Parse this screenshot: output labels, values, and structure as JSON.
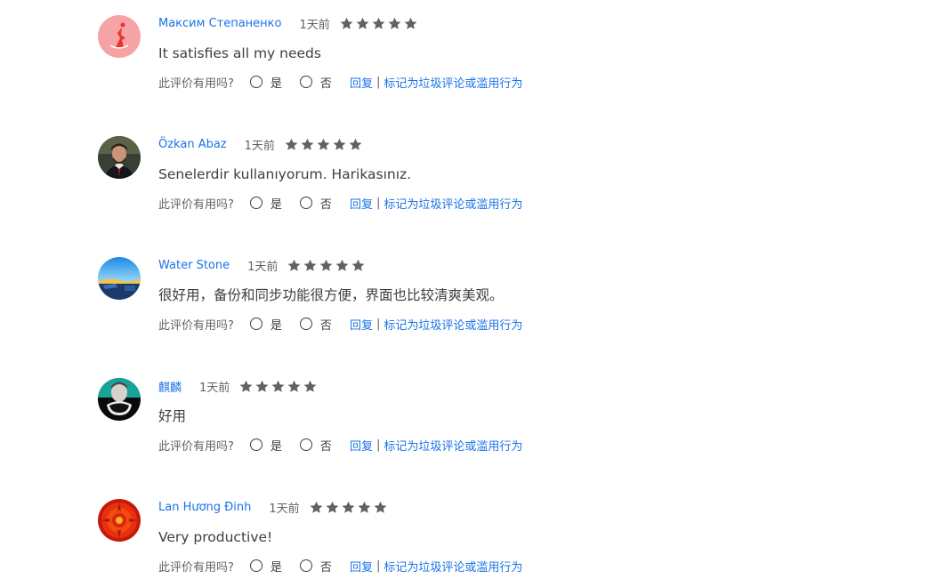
{
  "reviews": [
    {
      "author": "Максим Степаненко",
      "date": "1天前",
      "rating": 5,
      "text": "It satisfies all my needs",
      "avatar": "pink-abstract-avatar"
    },
    {
      "author": "Özkan Abaz",
      "date": "1天前",
      "rating": 5,
      "text": "Senelerdir kullanıyorum. Harikasınız.",
      "avatar": "man-portrait-avatar"
    },
    {
      "author": "Water Stone",
      "date": "1天前",
      "rating": 5,
      "text": "很好用，备份和同步功能很方便，界面也比较清爽美观。",
      "avatar": "landscape-avatar"
    },
    {
      "author": "麒麟",
      "date": "1天前",
      "rating": 5,
      "text": "好用",
      "avatar": "teal-figure-avatar"
    },
    {
      "author": "Lan Hương Đinh",
      "date": "1天前",
      "rating": 5,
      "text": "Very productive!",
      "avatar": "red-flower-avatar"
    }
  ],
  "labels": {
    "helpful_question": "此评价有用吗?",
    "yes": "是",
    "no": "否",
    "reply": "回复",
    "separator": "|",
    "report": "标记为垃圾评论或滥用行为"
  },
  "colors": {
    "link": "#1a73e8",
    "star": "#5f6368",
    "text": "#3c4043"
  }
}
